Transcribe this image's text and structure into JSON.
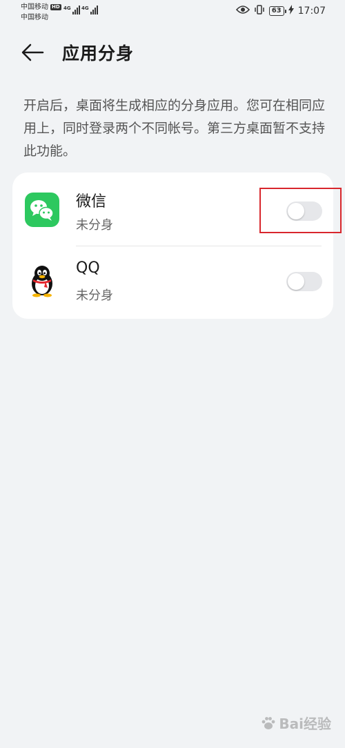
{
  "status_bar": {
    "carrier_1": "中国移动",
    "hd_badge": "HD",
    "carrier_2": "中国移动",
    "network_1": "4G",
    "network_2": "4G",
    "battery_level": "63",
    "time": "17:07"
  },
  "header": {
    "title": "应用分身"
  },
  "description": "开启后，桌面将生成相应的分身应用。您可在相同应用上，同时登录两个不同帐号。第三方桌面暂不支持此功能。",
  "apps": [
    {
      "name": "微信",
      "status": "未分身",
      "icon": "wechat-icon",
      "enabled": false
    },
    {
      "name": "QQ",
      "status": "未分身",
      "icon": "qq-penguin-icon",
      "enabled": false
    }
  ],
  "watermark": "Bai经验",
  "colors": {
    "background": "#f1f3f5",
    "card": "#ffffff",
    "wechat_green": "#2dc85f",
    "toggle_off": "#e6e7ea",
    "highlight_red": "#d8262c"
  }
}
